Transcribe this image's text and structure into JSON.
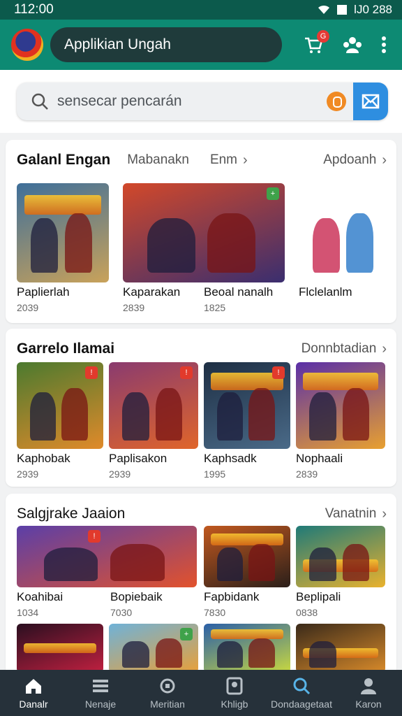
{
  "status": {
    "time": "112:00",
    "right": "lJ0 288"
  },
  "appbar": {
    "title": "Applikian Ungah",
    "cart_badge": "G"
  },
  "search": {
    "placeholder": "sensecar pencarán"
  },
  "sections": [
    {
      "title": "Galanl Engan",
      "tabs": [
        "Mabanakn",
        "Enm"
      ],
      "more": "Apdoanh",
      "cards": [
        {
          "title": "Paplierlah",
          "sub": "2039",
          "colors": [
            "#3e6f9a",
            "#c9a25a"
          ]
        },
        {
          "title": "Kaparakan",
          "sub": "2839",
          "colors": [
            "#d2482a",
            "#3a2e6f"
          ]
        },
        {
          "title": "Beoal nanalh",
          "sub": "1825",
          "colors": []
        },
        {
          "title": "Flclelanlm",
          "sub": "",
          "colors": [
            "#ffffff",
            "#ffffff"
          ]
        }
      ]
    },
    {
      "title": "Garrelo Ilamai",
      "more": "Donnbtadian",
      "cards": [
        {
          "title": "Kaphobak",
          "sub": "2939",
          "colors": [
            "#4b7a2f",
            "#e08a2a"
          ]
        },
        {
          "title": "Paplisakon",
          "sub": "2939",
          "colors": [
            "#8a3b6f",
            "#e0652a"
          ]
        },
        {
          "title": "Kaphsadk",
          "sub": "1995",
          "colors": [
            "#1e2f44",
            "#4a6a88"
          ]
        },
        {
          "title": "Nophaali",
          "sub": "2839",
          "colors": [
            "#5a2fa8",
            "#e8a030"
          ]
        }
      ]
    },
    {
      "title": "Salgjrake Jaaion",
      "more": "Vanatnin",
      "cards": [
        {
          "title": "Koahibai",
          "sub": "1034",
          "colors": [
            "#5b3fa8",
            "#e2522c"
          ]
        },
        {
          "title": "Bopiebaik",
          "sub": "7030",
          "colors": []
        },
        {
          "title": "Fapbidank",
          "sub": "7830",
          "colors": [
            "#c0581f",
            "#2b1f1a"
          ]
        },
        {
          "title": "Beplipali",
          "sub": "0838",
          "colors": [
            "#1f7a78",
            "#e9b22e"
          ]
        },
        {
          "title": "",
          "sub": "",
          "colors": [
            "#2a0f20",
            "#c02040"
          ]
        },
        {
          "title": "",
          "sub": "",
          "colors": [
            "#6fb2d8",
            "#e8a03a"
          ]
        },
        {
          "title": "",
          "sub": "",
          "colors": [
            "#2a5fa8",
            "#c8d840"
          ]
        },
        {
          "title": "",
          "sub": "",
          "colors": [
            "#3a2a1a",
            "#d88a2a"
          ]
        }
      ]
    }
  ],
  "bottomnav": [
    {
      "label": "Danalr",
      "icon": "home-icon"
    },
    {
      "label": "Nenaje",
      "icon": "list-icon"
    },
    {
      "label": "Meritian",
      "icon": "gamepad-icon"
    },
    {
      "label": "Khligb",
      "icon": "library-icon"
    },
    {
      "label": "Dondaagetaat",
      "icon": "search-icon"
    },
    {
      "label": "Karon",
      "icon": "profile-icon"
    }
  ]
}
